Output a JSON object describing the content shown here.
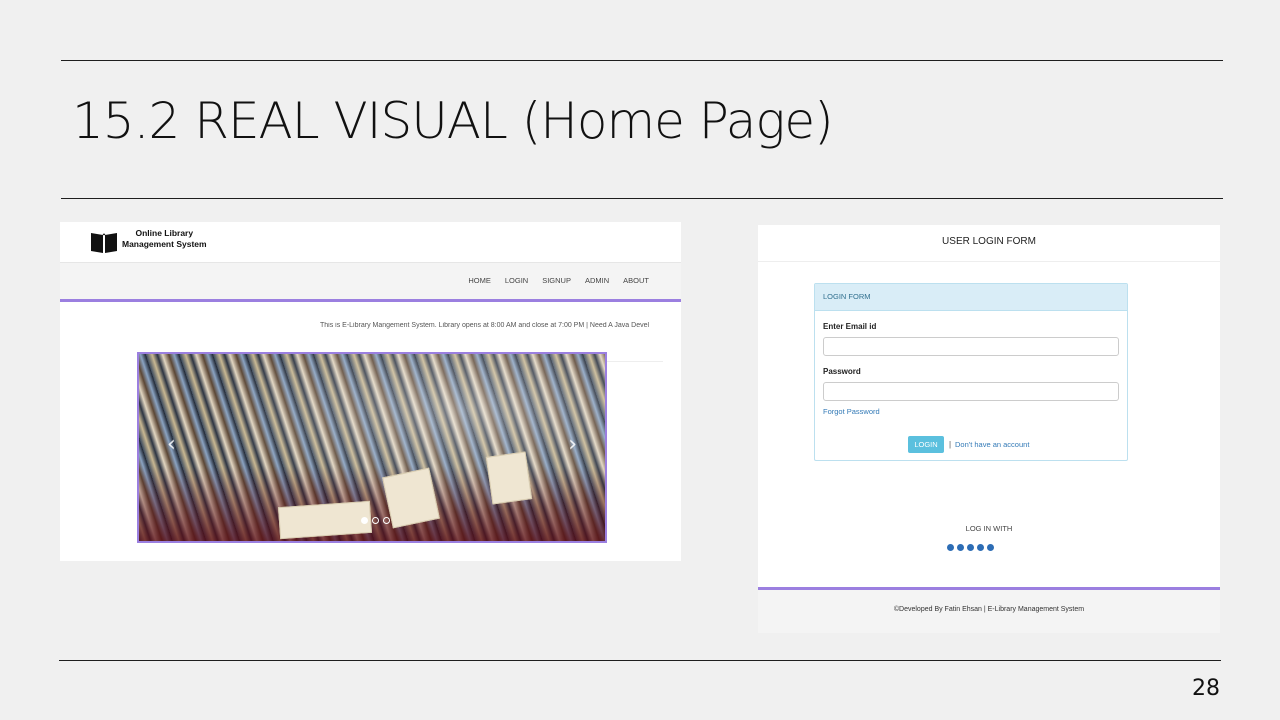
{
  "slide": {
    "title": "15.2 REAL VISUAL (Home Page)",
    "page_number": "28"
  },
  "home_page": {
    "brand_line1": "Online Library",
    "brand_line2": "Management System",
    "nav": [
      "HOME",
      "LOGIN",
      "SIGNUP",
      "ADMIN",
      "ABOUT"
    ],
    "marquee": "This is E-Library Mangement System. Library opens at 8:00 AM and close at 7:00 PM | Need A Java Devel",
    "carousel": {
      "prev_icon": "chevron-left-icon",
      "next_icon": "chevron-right-icon",
      "slide_count": 3,
      "active_slide": 1
    },
    "accent_color": "#9b7fe0"
  },
  "login_page": {
    "title": "USER LOGIN FORM",
    "panel_heading": "LOGIN FORM",
    "email_label": "Enter Email id",
    "email_value": "",
    "password_label": "Password",
    "password_value": "",
    "forgot": "Forgot Password",
    "login_button": "LOGIN",
    "separator": "|",
    "signup_link": "Don't have an account",
    "login_with": "LOG IN WITH",
    "social_icons": [
      "facebook-icon",
      "instagram-icon",
      "twitter-icon",
      "google-icon",
      "skype-icon"
    ],
    "footer": "©Developed By Fatin Ehsan | E-Library Management System",
    "panel_color": "#d9edf7",
    "button_color": "#5bc0de"
  }
}
